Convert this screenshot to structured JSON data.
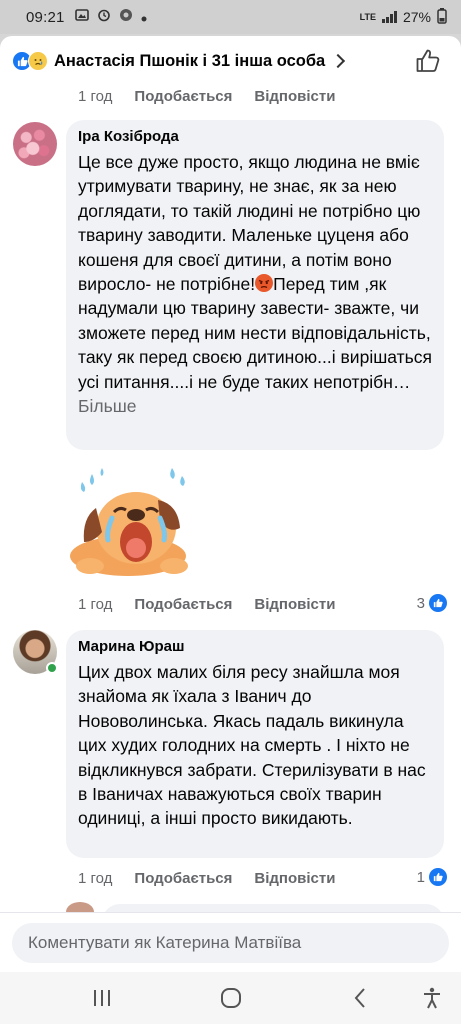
{
  "status": {
    "time": "09:21",
    "battery": "27%",
    "network": "LTE"
  },
  "header": {
    "title": "Анастасія Пшонік і 31 інша особа"
  },
  "top_meta": {
    "time": "1 год",
    "like_label": "Подобається",
    "reply_label": "Відповісти"
  },
  "comments": [
    {
      "author": "Іра Козіброда",
      "text": "Це все дуже просто, якщо  людина не вміє утримувати тварину, не знає, як за нею доглядати, то такій людині не потрібно цю тварину заводити. Маленьке цуценя або кошеня для своєї дитини, а потім воно виросло- не потрібне!",
      "text_after_emoji": "Перед тим ,як надумали цю тварину завести- зважте, чи зможете перед ним нести відповідальність, таку як перед своєю дитиною...і вирішаться усі питання....і не буде таких непотрібн…",
      "more": "Більше",
      "time": "1 год",
      "like_label": "Подобається",
      "reply_label": "Відповісти",
      "reaction_count": "3"
    },
    {
      "author": "Марина Юраш",
      "text": "Цих двох малих біля ресу знайшла моя знайома як їхала з Іванич до Нововолинська. Якась падаль викинула цих худих голодних на смерть . І ніхто не відкликнувся забрати. Стерилізувати в нас в Іваничах наважуються своїх тварин одиниці, а інші просто викидають.",
      "time": "1 год",
      "like_label": "Подобається",
      "reply_label": "Відповісти",
      "reaction_count": "1"
    }
  ],
  "composer": {
    "placeholder": "Коментувати як Катерина Матвіїва"
  },
  "colors": {
    "like_blue": "#1877f2",
    "bubble_bg": "#f0f2f5",
    "meta_gray": "#65676b"
  }
}
